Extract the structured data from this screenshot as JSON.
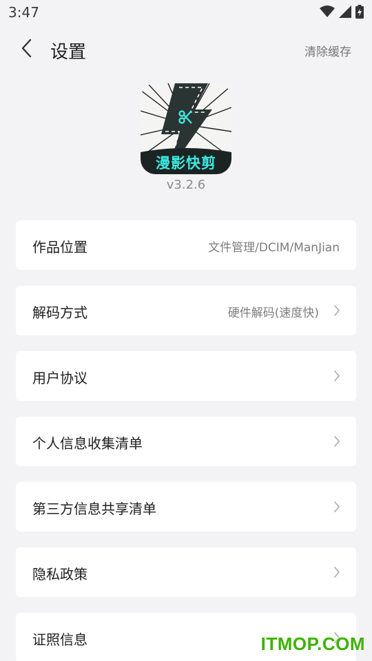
{
  "status_bar": {
    "time": "3:47",
    "icons": [
      "wifi-icon",
      "cellular-signal-icon",
      "battery-charging-icon"
    ]
  },
  "header": {
    "title": "设置",
    "clear_cache_label": "清除缓存",
    "back_icon": "chevron-left-icon"
  },
  "app": {
    "logo_text": "漫影快剪",
    "version": "v3.2.6"
  },
  "settings": {
    "items": [
      {
        "label": "作品位置",
        "value": "文件管理/DCIM/ManJian",
        "chevron": false
      },
      {
        "label": "解码方式",
        "value": "硬件解码(速度快)",
        "chevron": true
      },
      {
        "label": "用户协议",
        "value": "",
        "chevron": true
      },
      {
        "label": "个人信息收集清单",
        "value": "",
        "chevron": true
      },
      {
        "label": "第三方信息共享清单",
        "value": "",
        "chevron": true
      },
      {
        "label": "隐私政策",
        "value": "",
        "chevron": true
      },
      {
        "label": "证照信息",
        "value": "",
        "chevron": true
      }
    ]
  },
  "watermark": {
    "text": "ITMOP.COM"
  },
  "colors": {
    "background": "#f3f3f5",
    "card": "#ffffff",
    "accent_cyan": "#3ee8e0",
    "watermark_green": "#3cb300"
  }
}
